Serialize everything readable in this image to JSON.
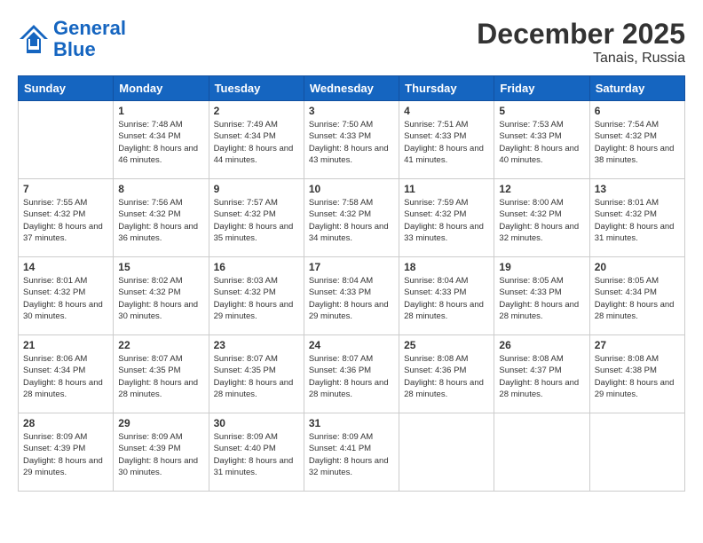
{
  "logo": {
    "line1": "General",
    "line2": "Blue"
  },
  "title": "December 2025",
  "subtitle": "Tanais, Russia",
  "days_of_week": [
    "Sunday",
    "Monday",
    "Tuesday",
    "Wednesday",
    "Thursday",
    "Friday",
    "Saturday"
  ],
  "weeks": [
    [
      {
        "day": "",
        "sunrise": "",
        "sunset": "",
        "daylight": ""
      },
      {
        "day": "1",
        "sunrise": "Sunrise: 7:48 AM",
        "sunset": "Sunset: 4:34 PM",
        "daylight": "Daylight: 8 hours and 46 minutes."
      },
      {
        "day": "2",
        "sunrise": "Sunrise: 7:49 AM",
        "sunset": "Sunset: 4:34 PM",
        "daylight": "Daylight: 8 hours and 44 minutes."
      },
      {
        "day": "3",
        "sunrise": "Sunrise: 7:50 AM",
        "sunset": "Sunset: 4:33 PM",
        "daylight": "Daylight: 8 hours and 43 minutes."
      },
      {
        "day": "4",
        "sunrise": "Sunrise: 7:51 AM",
        "sunset": "Sunset: 4:33 PM",
        "daylight": "Daylight: 8 hours and 41 minutes."
      },
      {
        "day": "5",
        "sunrise": "Sunrise: 7:53 AM",
        "sunset": "Sunset: 4:33 PM",
        "daylight": "Daylight: 8 hours and 40 minutes."
      },
      {
        "day": "6",
        "sunrise": "Sunrise: 7:54 AM",
        "sunset": "Sunset: 4:32 PM",
        "daylight": "Daylight: 8 hours and 38 minutes."
      }
    ],
    [
      {
        "day": "7",
        "sunrise": "Sunrise: 7:55 AM",
        "sunset": "Sunset: 4:32 PM",
        "daylight": "Daylight: 8 hours and 37 minutes."
      },
      {
        "day": "8",
        "sunrise": "Sunrise: 7:56 AM",
        "sunset": "Sunset: 4:32 PM",
        "daylight": "Daylight: 8 hours and 36 minutes."
      },
      {
        "day": "9",
        "sunrise": "Sunrise: 7:57 AM",
        "sunset": "Sunset: 4:32 PM",
        "daylight": "Daylight: 8 hours and 35 minutes."
      },
      {
        "day": "10",
        "sunrise": "Sunrise: 7:58 AM",
        "sunset": "Sunset: 4:32 PM",
        "daylight": "Daylight: 8 hours and 34 minutes."
      },
      {
        "day": "11",
        "sunrise": "Sunrise: 7:59 AM",
        "sunset": "Sunset: 4:32 PM",
        "daylight": "Daylight: 8 hours and 33 minutes."
      },
      {
        "day": "12",
        "sunrise": "Sunrise: 8:00 AM",
        "sunset": "Sunset: 4:32 PM",
        "daylight": "Daylight: 8 hours and 32 minutes."
      },
      {
        "day": "13",
        "sunrise": "Sunrise: 8:01 AM",
        "sunset": "Sunset: 4:32 PM",
        "daylight": "Daylight: 8 hours and 31 minutes."
      }
    ],
    [
      {
        "day": "14",
        "sunrise": "Sunrise: 8:01 AM",
        "sunset": "Sunset: 4:32 PM",
        "daylight": "Daylight: 8 hours and 30 minutes."
      },
      {
        "day": "15",
        "sunrise": "Sunrise: 8:02 AM",
        "sunset": "Sunset: 4:32 PM",
        "daylight": "Daylight: 8 hours and 30 minutes."
      },
      {
        "day": "16",
        "sunrise": "Sunrise: 8:03 AM",
        "sunset": "Sunset: 4:32 PM",
        "daylight": "Daylight: 8 hours and 29 minutes."
      },
      {
        "day": "17",
        "sunrise": "Sunrise: 8:04 AM",
        "sunset": "Sunset: 4:33 PM",
        "daylight": "Daylight: 8 hours and 29 minutes."
      },
      {
        "day": "18",
        "sunrise": "Sunrise: 8:04 AM",
        "sunset": "Sunset: 4:33 PM",
        "daylight": "Daylight: 8 hours and 28 minutes."
      },
      {
        "day": "19",
        "sunrise": "Sunrise: 8:05 AM",
        "sunset": "Sunset: 4:33 PM",
        "daylight": "Daylight: 8 hours and 28 minutes."
      },
      {
        "day": "20",
        "sunrise": "Sunrise: 8:05 AM",
        "sunset": "Sunset: 4:34 PM",
        "daylight": "Daylight: 8 hours and 28 minutes."
      }
    ],
    [
      {
        "day": "21",
        "sunrise": "Sunrise: 8:06 AM",
        "sunset": "Sunset: 4:34 PM",
        "daylight": "Daylight: 8 hours and 28 minutes."
      },
      {
        "day": "22",
        "sunrise": "Sunrise: 8:07 AM",
        "sunset": "Sunset: 4:35 PM",
        "daylight": "Daylight: 8 hours and 28 minutes."
      },
      {
        "day": "23",
        "sunrise": "Sunrise: 8:07 AM",
        "sunset": "Sunset: 4:35 PM",
        "daylight": "Daylight: 8 hours and 28 minutes."
      },
      {
        "day": "24",
        "sunrise": "Sunrise: 8:07 AM",
        "sunset": "Sunset: 4:36 PM",
        "daylight": "Daylight: 8 hours and 28 minutes."
      },
      {
        "day": "25",
        "sunrise": "Sunrise: 8:08 AM",
        "sunset": "Sunset: 4:36 PM",
        "daylight": "Daylight: 8 hours and 28 minutes."
      },
      {
        "day": "26",
        "sunrise": "Sunrise: 8:08 AM",
        "sunset": "Sunset: 4:37 PM",
        "daylight": "Daylight: 8 hours and 28 minutes."
      },
      {
        "day": "27",
        "sunrise": "Sunrise: 8:08 AM",
        "sunset": "Sunset: 4:38 PM",
        "daylight": "Daylight: 8 hours and 29 minutes."
      }
    ],
    [
      {
        "day": "28",
        "sunrise": "Sunrise: 8:09 AM",
        "sunset": "Sunset: 4:39 PM",
        "daylight": "Daylight: 8 hours and 29 minutes."
      },
      {
        "day": "29",
        "sunrise": "Sunrise: 8:09 AM",
        "sunset": "Sunset: 4:39 PM",
        "daylight": "Daylight: 8 hours and 30 minutes."
      },
      {
        "day": "30",
        "sunrise": "Sunrise: 8:09 AM",
        "sunset": "Sunset: 4:40 PM",
        "daylight": "Daylight: 8 hours and 31 minutes."
      },
      {
        "day": "31",
        "sunrise": "Sunrise: 8:09 AM",
        "sunset": "Sunset: 4:41 PM",
        "daylight": "Daylight: 8 hours and 32 minutes."
      },
      {
        "day": "",
        "sunrise": "",
        "sunset": "",
        "daylight": ""
      },
      {
        "day": "",
        "sunrise": "",
        "sunset": "",
        "daylight": ""
      },
      {
        "day": "",
        "sunrise": "",
        "sunset": "",
        "daylight": ""
      }
    ]
  ]
}
